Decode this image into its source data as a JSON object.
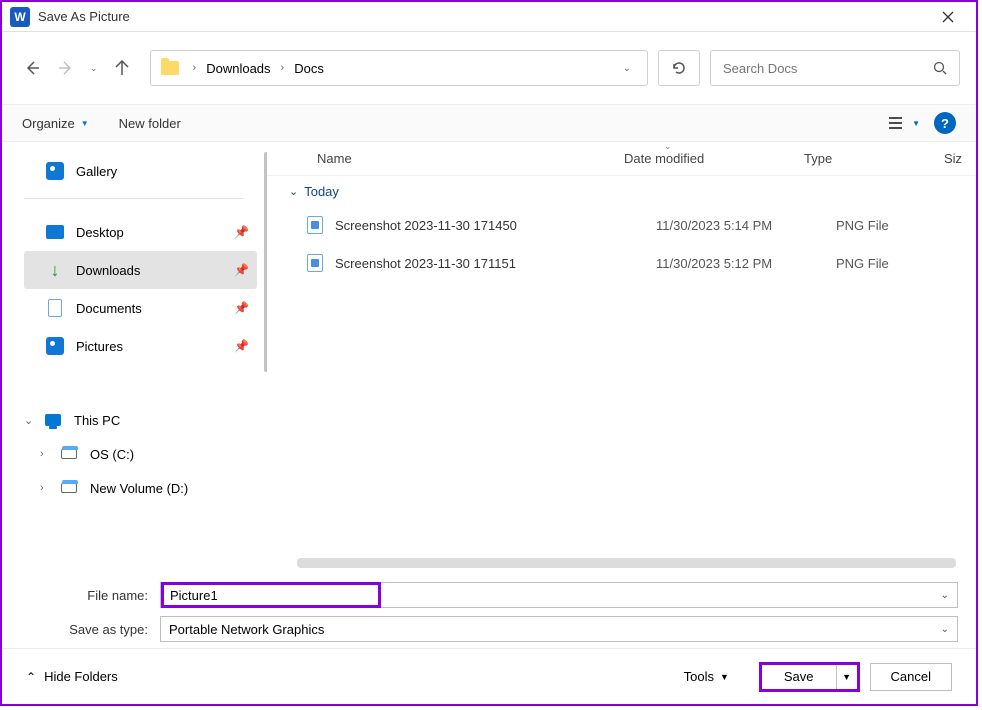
{
  "title": "Save As Picture",
  "breadcrumbs": [
    "Downloads",
    "Docs"
  ],
  "search_placeholder": "Search Docs",
  "toolbar": {
    "organize": "Organize",
    "newfolder": "New folder"
  },
  "sidebar": {
    "gallery": "Gallery",
    "desktop": "Desktop",
    "downloads": "Downloads",
    "documents": "Documents",
    "pictures": "Pictures",
    "thispc": "This PC",
    "drive_c": "OS (C:)",
    "drive_d": "New Volume (D:)"
  },
  "columns": {
    "name": "Name",
    "date": "Date modified",
    "type": "Type",
    "size": "Siz"
  },
  "group": "Today",
  "files": [
    {
      "name": "Screenshot 2023-11-30 171450",
      "date": "11/30/2023 5:14 PM",
      "type": "PNG File"
    },
    {
      "name": "Screenshot 2023-11-30 171151",
      "date": "11/30/2023 5:12 PM",
      "type": "PNG File"
    }
  ],
  "filenamelabel": "File name:",
  "filename": "Picture1",
  "typelabel": "Save as type:",
  "saveastype": "Portable Network Graphics",
  "footer": {
    "hide": "Hide Folders",
    "tools": "Tools",
    "save": "Save",
    "cancel": "Cancel"
  }
}
